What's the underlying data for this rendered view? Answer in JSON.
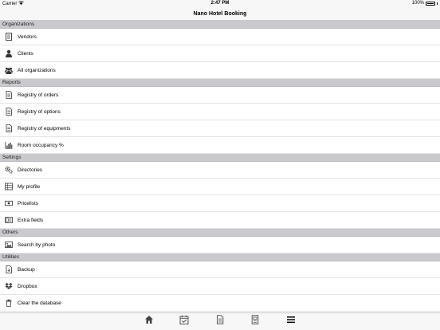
{
  "status_bar": {
    "carrier": "Carrier",
    "time": "2:47 PM",
    "battery": "100%"
  },
  "nav": {
    "title": "Nano Hotel Booking"
  },
  "sections": [
    {
      "header": "Organizations",
      "items": [
        {
          "label": "Vendors",
          "icon": "vendors-icon"
        },
        {
          "label": "Clients",
          "icon": "person-icon"
        },
        {
          "label": "All organizations",
          "icon": "people-icon"
        }
      ]
    },
    {
      "header": "Reports",
      "items": [
        {
          "label": "Registry of orders",
          "icon": "document-icon"
        },
        {
          "label": "Registry of options",
          "icon": "document-icon"
        },
        {
          "label": "Registry of equipments",
          "icon": "document-icon"
        },
        {
          "label": "Room occupancy %",
          "icon": "bar-chart-icon"
        }
      ]
    },
    {
      "header": "Settings",
      "items": [
        {
          "label": "Directories",
          "icon": "gears-icon"
        },
        {
          "label": "My profile",
          "icon": "grid-icon"
        },
        {
          "label": "Pricelists",
          "icon": "money-icon"
        },
        {
          "label": "Extra fields",
          "icon": "form-icon"
        }
      ]
    },
    {
      "header": "Others",
      "items": [
        {
          "label": "Search by photo",
          "icon": "photo-icon"
        }
      ]
    },
    {
      "header": "Utilities",
      "items": [
        {
          "label": "Backup",
          "icon": "backup-icon"
        },
        {
          "label": "Dropbox",
          "icon": "dropbox-icon"
        },
        {
          "label": "Clear the database",
          "icon": "trash-icon"
        }
      ]
    }
  ],
  "tabs": [
    {
      "label": "Main",
      "icon": "home-icon",
      "active": false
    },
    {
      "label": "Calendar",
      "icon": "calendar-icon",
      "active": false
    },
    {
      "label": "Orders",
      "icon": "orders-icon",
      "active": false
    },
    {
      "label": "Rooms",
      "icon": "rooms-icon",
      "active": false
    },
    {
      "label": "More",
      "icon": "menu-icon",
      "active": true
    }
  ]
}
